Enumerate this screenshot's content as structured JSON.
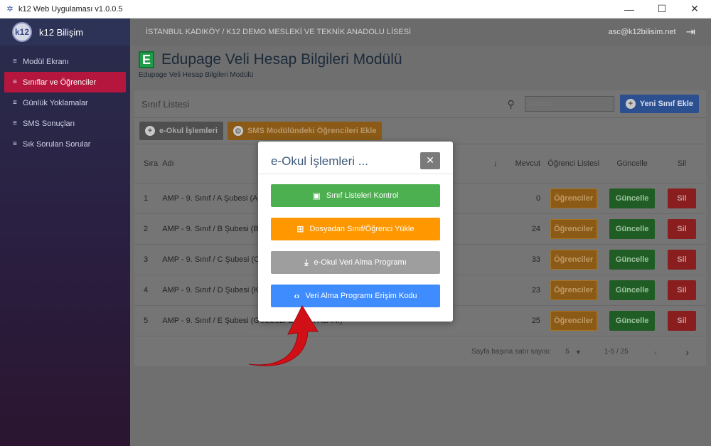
{
  "window": {
    "title": "k12 Web Uygulaması v1.0.0.5",
    "minimize": "—",
    "maximize": "☐",
    "close": "✕"
  },
  "sidebar": {
    "brand": "k12 Bilişim",
    "items": [
      {
        "label": "Modül Ekranı",
        "active": false
      },
      {
        "label": "Sınıflar ve Öğrenciler",
        "active": true
      },
      {
        "label": "Günlük Yoklamalar",
        "active": false
      },
      {
        "label": "SMS Sonuçları",
        "active": false
      },
      {
        "label": "Sık Sorulan Sorular",
        "active": false
      }
    ]
  },
  "topbar": {
    "school": "İSTANBUL KADIKÖY / K12 DEMO MESLEKİ VE TEKNİK ANADOLU LİSESİ",
    "email": "asc@k12bilisim.net"
  },
  "header": {
    "logo_letter": "E",
    "title": "Edupage Veli Hesap Bilgileri Modülü",
    "subtitle": "Edupage Veli Hesap Bilgileri Modülü"
  },
  "list": {
    "title": "Sınıf Listesi",
    "search_placeholder": "Arama",
    "new_button": "Yeni Sınıf Ekle",
    "eokul_button": "e-Okul İşlemleri",
    "sms_button": "SMS Modülündeki Öğrencileri Ekle"
  },
  "table": {
    "headers": {
      "sira": "Sıra",
      "adi": "Adı",
      "mevcut": "Mevcut",
      "ogrenci_listesi": "Öğrenci Listesi",
      "guncelle": "Güncelle",
      "sil": "Sil"
    },
    "rows": [
      {
        "sira": "1",
        "adi": "AMP -  9. Sınıf / A Şubesi (A",
        "mevcut": "0",
        "ogr": "Öğrenciler",
        "gun": "Güncelle",
        "sil": "Sil"
      },
      {
        "sira": "2",
        "adi": "AMP -  9. Sınıf / B Şubesi (B",
        "mevcut": "24",
        "ogr": "Öğrenciler",
        "gun": "Güncelle",
        "sil": "Sil"
      },
      {
        "sira": "3",
        "adi": "AMP -  9. Sınıf / C Şubesi (C",
        "mevcut": "33",
        "ogr": "Öğrenciler",
        "gun": "Güncelle",
        "sil": "Sil"
      },
      {
        "sira": "4",
        "adi": "AMP -  9. Sınıf / D Şubesi (K",
        "mevcut": "23",
        "ogr": "Öğrenciler",
        "gun": "Güncelle",
        "sil": "Sil"
      },
      {
        "sira": "5",
        "adi": "AMP -  9. Sınıf / E Şubesi (GÜZELLİ      ETLERİ ALANI)",
        "mevcut": "25",
        "ogr": "Öğrenciler",
        "gun": "Güncelle",
        "sil": "Sil"
      }
    ]
  },
  "pager": {
    "rows_per_page_label": "Sayfa başına satır sayısı:",
    "rows_per_page": "5",
    "range": "1-5 / 25"
  },
  "modal": {
    "title": "e-Okul İşlemleri ...",
    "buttons": [
      {
        "label": "Sınıf Listeleri Kontrol",
        "icon": "file-check-icon",
        "color": "#4caf50"
      },
      {
        "label": "Dosyadan Sınıf/Öğrenci Yükle",
        "icon": "file-plus-icon",
        "color": "#ff9800"
      },
      {
        "label": "e-Okul Veri Alma Programı",
        "icon": "download-icon",
        "color": "#9e9e9e"
      },
      {
        "label": "Veri Alma Programı Erişim Kodu",
        "icon": "code-icon",
        "color": "#3f8cff"
      }
    ]
  },
  "colors": {
    "active_nav": "#b5163e",
    "arrow": "#d10f17"
  }
}
